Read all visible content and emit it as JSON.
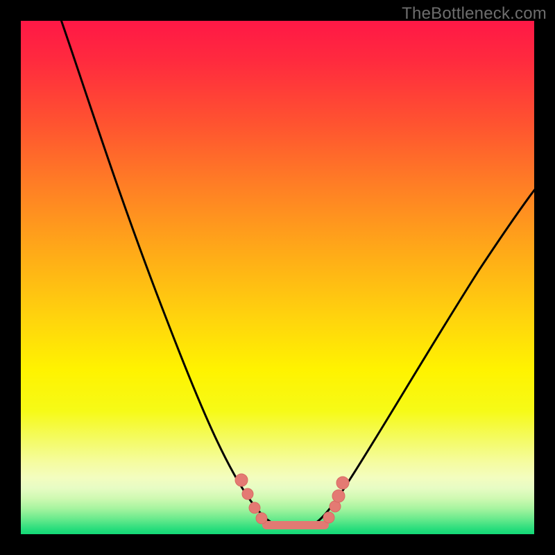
{
  "watermark": "TheBottleneck.com",
  "colors": {
    "frame": "#000000",
    "gradient_top": "#ff1846",
    "gradient_mid": "#fff300",
    "gradient_bottom": "#13d877",
    "curve": "#000000",
    "marker_fill": "#e47a73"
  },
  "chart_data": {
    "type": "line",
    "title": "",
    "xlabel": "",
    "ylabel": "",
    "xlim": [
      0,
      100
    ],
    "ylim": [
      0,
      100
    ],
    "series": [
      {
        "name": "left-branch",
        "x": [
          8,
          12,
          18,
          24,
          30,
          36,
          40,
          44,
          46,
          48,
          50
        ],
        "y": [
          100,
          88,
          72,
          56,
          40,
          26,
          17,
          9,
          5,
          2,
          1
        ]
      },
      {
        "name": "right-branch",
        "x": [
          56,
          58,
          60,
          63,
          68,
          75,
          83,
          92,
          100
        ],
        "y": [
          1,
          2,
          5,
          10,
          20,
          33,
          47,
          60,
          70
        ]
      },
      {
        "name": "valley-flat",
        "x": [
          48,
          50,
          52,
          54,
          56
        ],
        "y": [
          1,
          0.5,
          0.5,
          0.5,
          1
        ]
      }
    ],
    "markers": [
      {
        "x": 43,
        "y": 10
      },
      {
        "x": 44.5,
        "y": 7
      },
      {
        "x": 46,
        "y": 4.5
      },
      {
        "x": 47.5,
        "y": 2.5
      },
      {
        "x": 49.5,
        "y": 1.2
      },
      {
        "x": 52,
        "y": 1
      },
      {
        "x": 54,
        "y": 1
      },
      {
        "x": 56,
        "y": 1.5
      },
      {
        "x": 58,
        "y": 3
      },
      {
        "x": 59.5,
        "y": 6
      },
      {
        "x": 61,
        "y": 10
      }
    ]
  }
}
